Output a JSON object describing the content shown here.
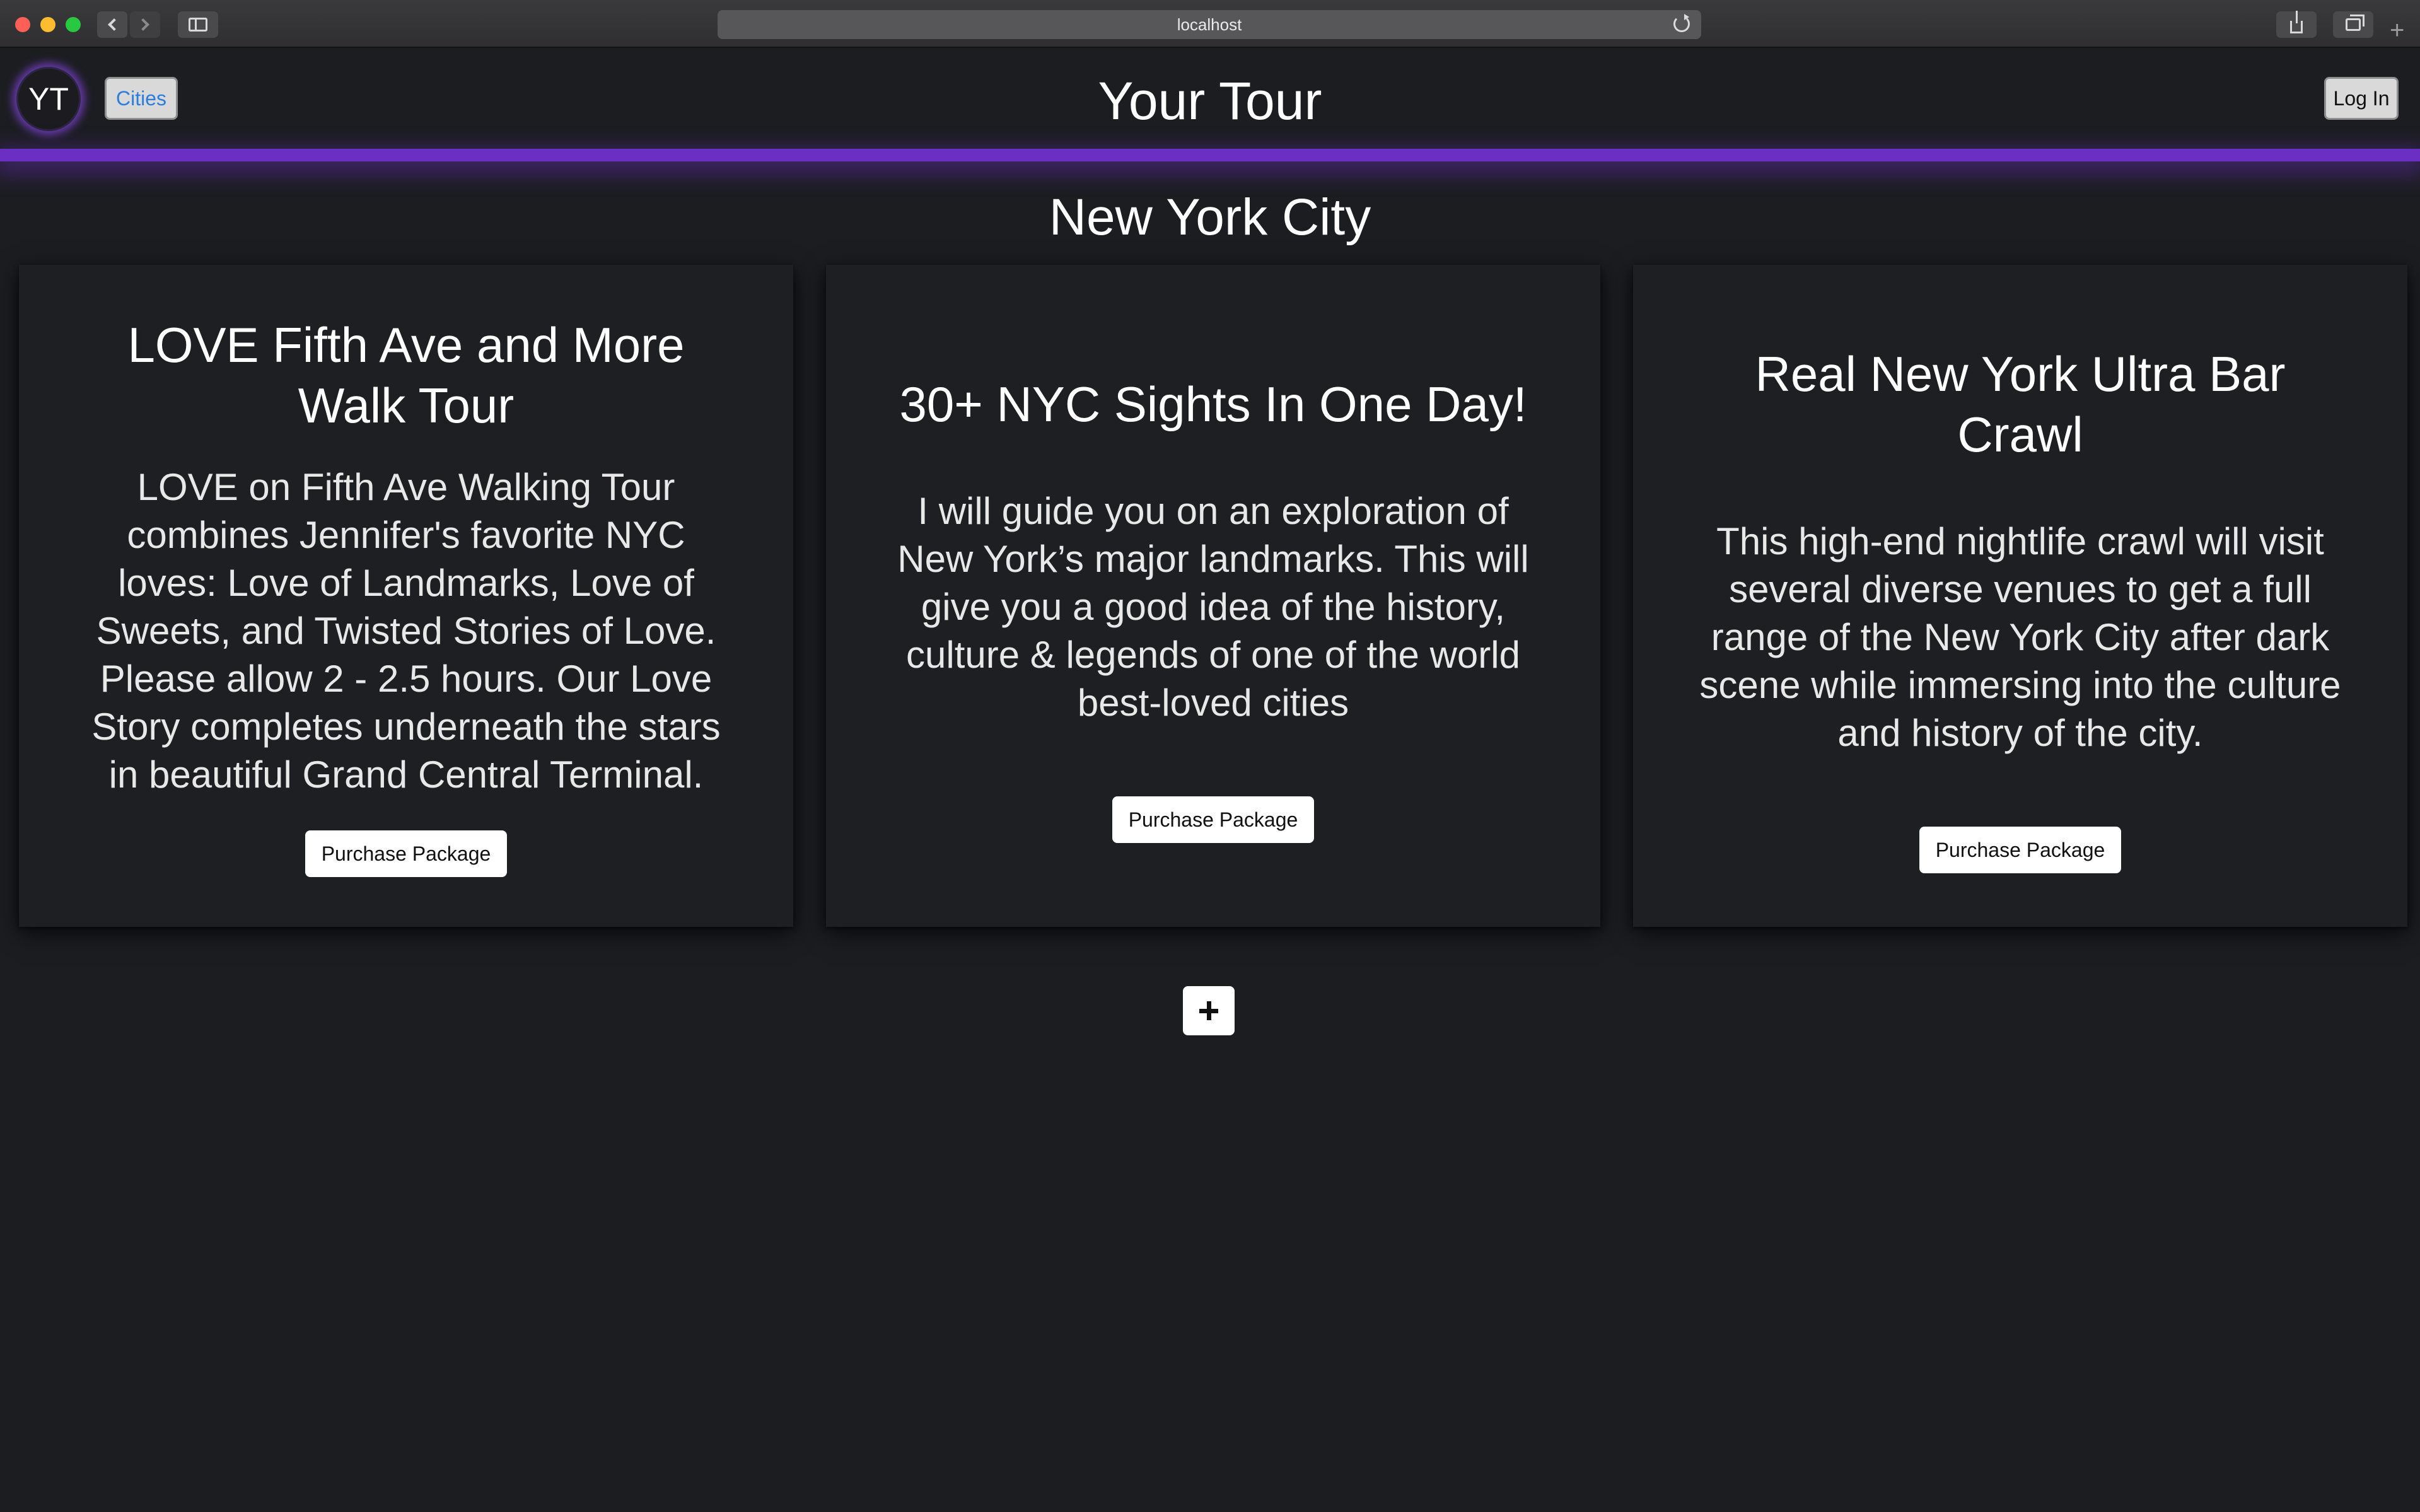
{
  "browser": {
    "url": "localhost"
  },
  "header": {
    "avatar_text": "YT",
    "cities_label": "Cities",
    "title": "Your Tour",
    "login_label": "Log In",
    "accent_color": "#6b2fc4",
    "link_color": "#2b7de0"
  },
  "main": {
    "city_title": "New York City",
    "tours": [
      {
        "title": "LOVE Fifth Ave and More Walk Tour",
        "description": "LOVE on Fifth Ave Walking Tour combines Jennifer's favorite NYC loves: Love of Landmarks, Love of Sweets, and Twisted Stories of Love. Please allow 2 - 2.5 hours. Our Love Story completes underneath the stars in beautiful Grand Central Terminal.",
        "button_label": "Purchase Package"
      },
      {
        "title": "30+ NYC Sights In One Day!",
        "description": "I will guide you on an exploration of New York’s major landmarks. This will give you a good idea of the history, culture & legends of one of the world best-loved cities",
        "button_label": "Purchase Package"
      },
      {
        "title": "Real New York Ultra Bar Crawl",
        "description": "This high-end nightlife crawl will visit several diverse venues to get a full range of the New York City after dark scene while immersing into the culture and history of the city.",
        "button_label": "Purchase Package"
      }
    ],
    "add_icon": "plus-icon"
  },
  "colors": {
    "background": "#1c1d21",
    "card": "#1e1f23"
  }
}
